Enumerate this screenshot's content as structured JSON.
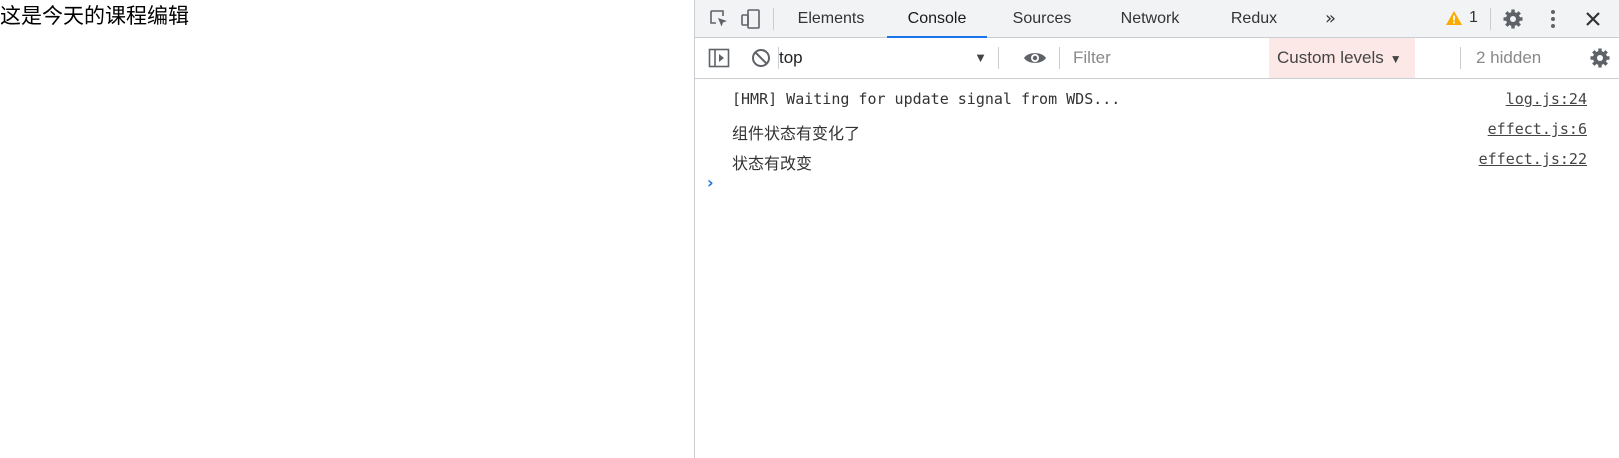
{
  "page": {
    "heading": "这是今天的课程编辑"
  },
  "devtools": {
    "tabs": [
      "Elements",
      "Console",
      "Sources",
      "Network",
      "Redux"
    ],
    "active_tab": "Console",
    "more_tabs_glyph": "»",
    "warning_count": "1",
    "icons": {
      "inspect": "inspect-element-icon",
      "device": "device-toolbar-icon",
      "settings": "gear-icon",
      "menu": "kebab-menu-icon",
      "close": "close-icon",
      "sidebar": "sidebar-toggle-icon",
      "clear": "clear-console-icon",
      "eye": "eye-icon",
      "console_settings": "gear-icon"
    },
    "colors": {
      "accent": "#1a73e8",
      "warning": "#f9ab00",
      "levels_bg": "#fce8e6"
    }
  },
  "toolbar": {
    "context": "top",
    "context_arrow": "▼",
    "filter_placeholder": "Filter",
    "levels_label": "Custom levels",
    "levels_arrow": "▼",
    "hidden": "2 hidden"
  },
  "console": {
    "messages": [
      {
        "text": "[HMR] Waiting for update signal from WDS...",
        "source": "log.js:24"
      },
      {
        "text": "组件状态有变化了",
        "source": "effect.js:6"
      },
      {
        "text": "状态有改变",
        "source": "effect.js:22"
      }
    ],
    "prompt": "›"
  }
}
